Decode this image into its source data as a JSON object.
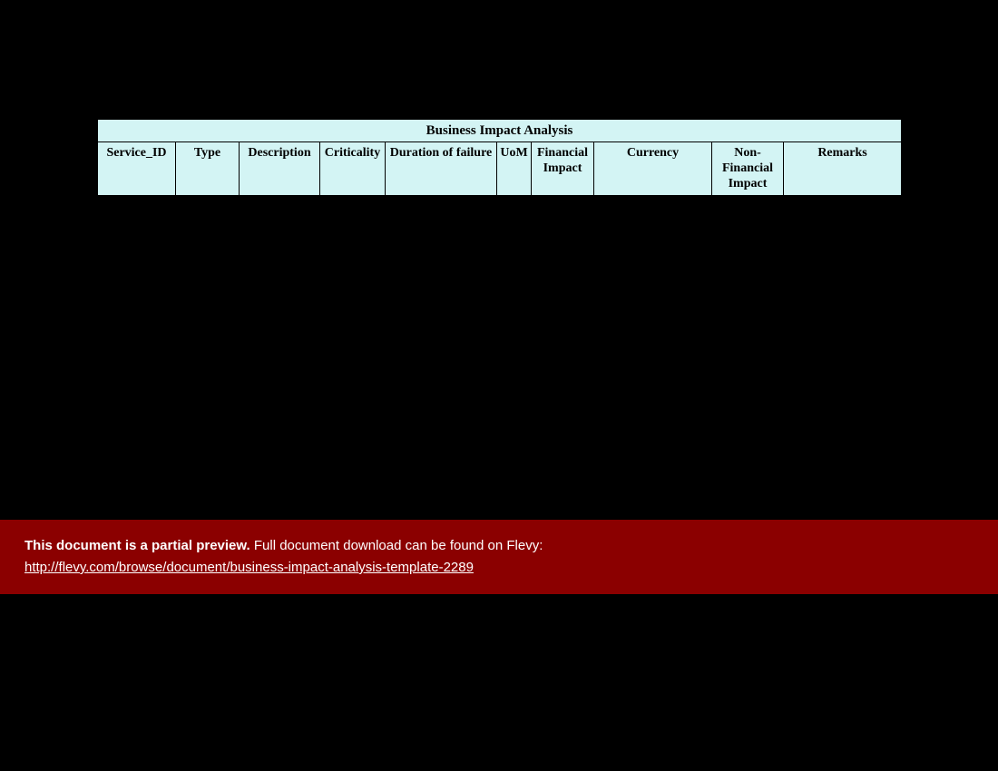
{
  "table": {
    "title": "Business Impact Analysis",
    "columns": [
      "Service_ID",
      "Type",
      "Description",
      "Criticality",
      "Duration of failure",
      "UoM",
      "Financial Impact",
      "Currency",
      "Non-Financial Impact",
      "Remarks"
    ]
  },
  "banner": {
    "strong": "This document is a partial preview.",
    "rest": "  Full document download can be found on Flevy:",
    "link_text": "http://flevy.com/browse/document/business-impact-analysis-template-2289"
  }
}
